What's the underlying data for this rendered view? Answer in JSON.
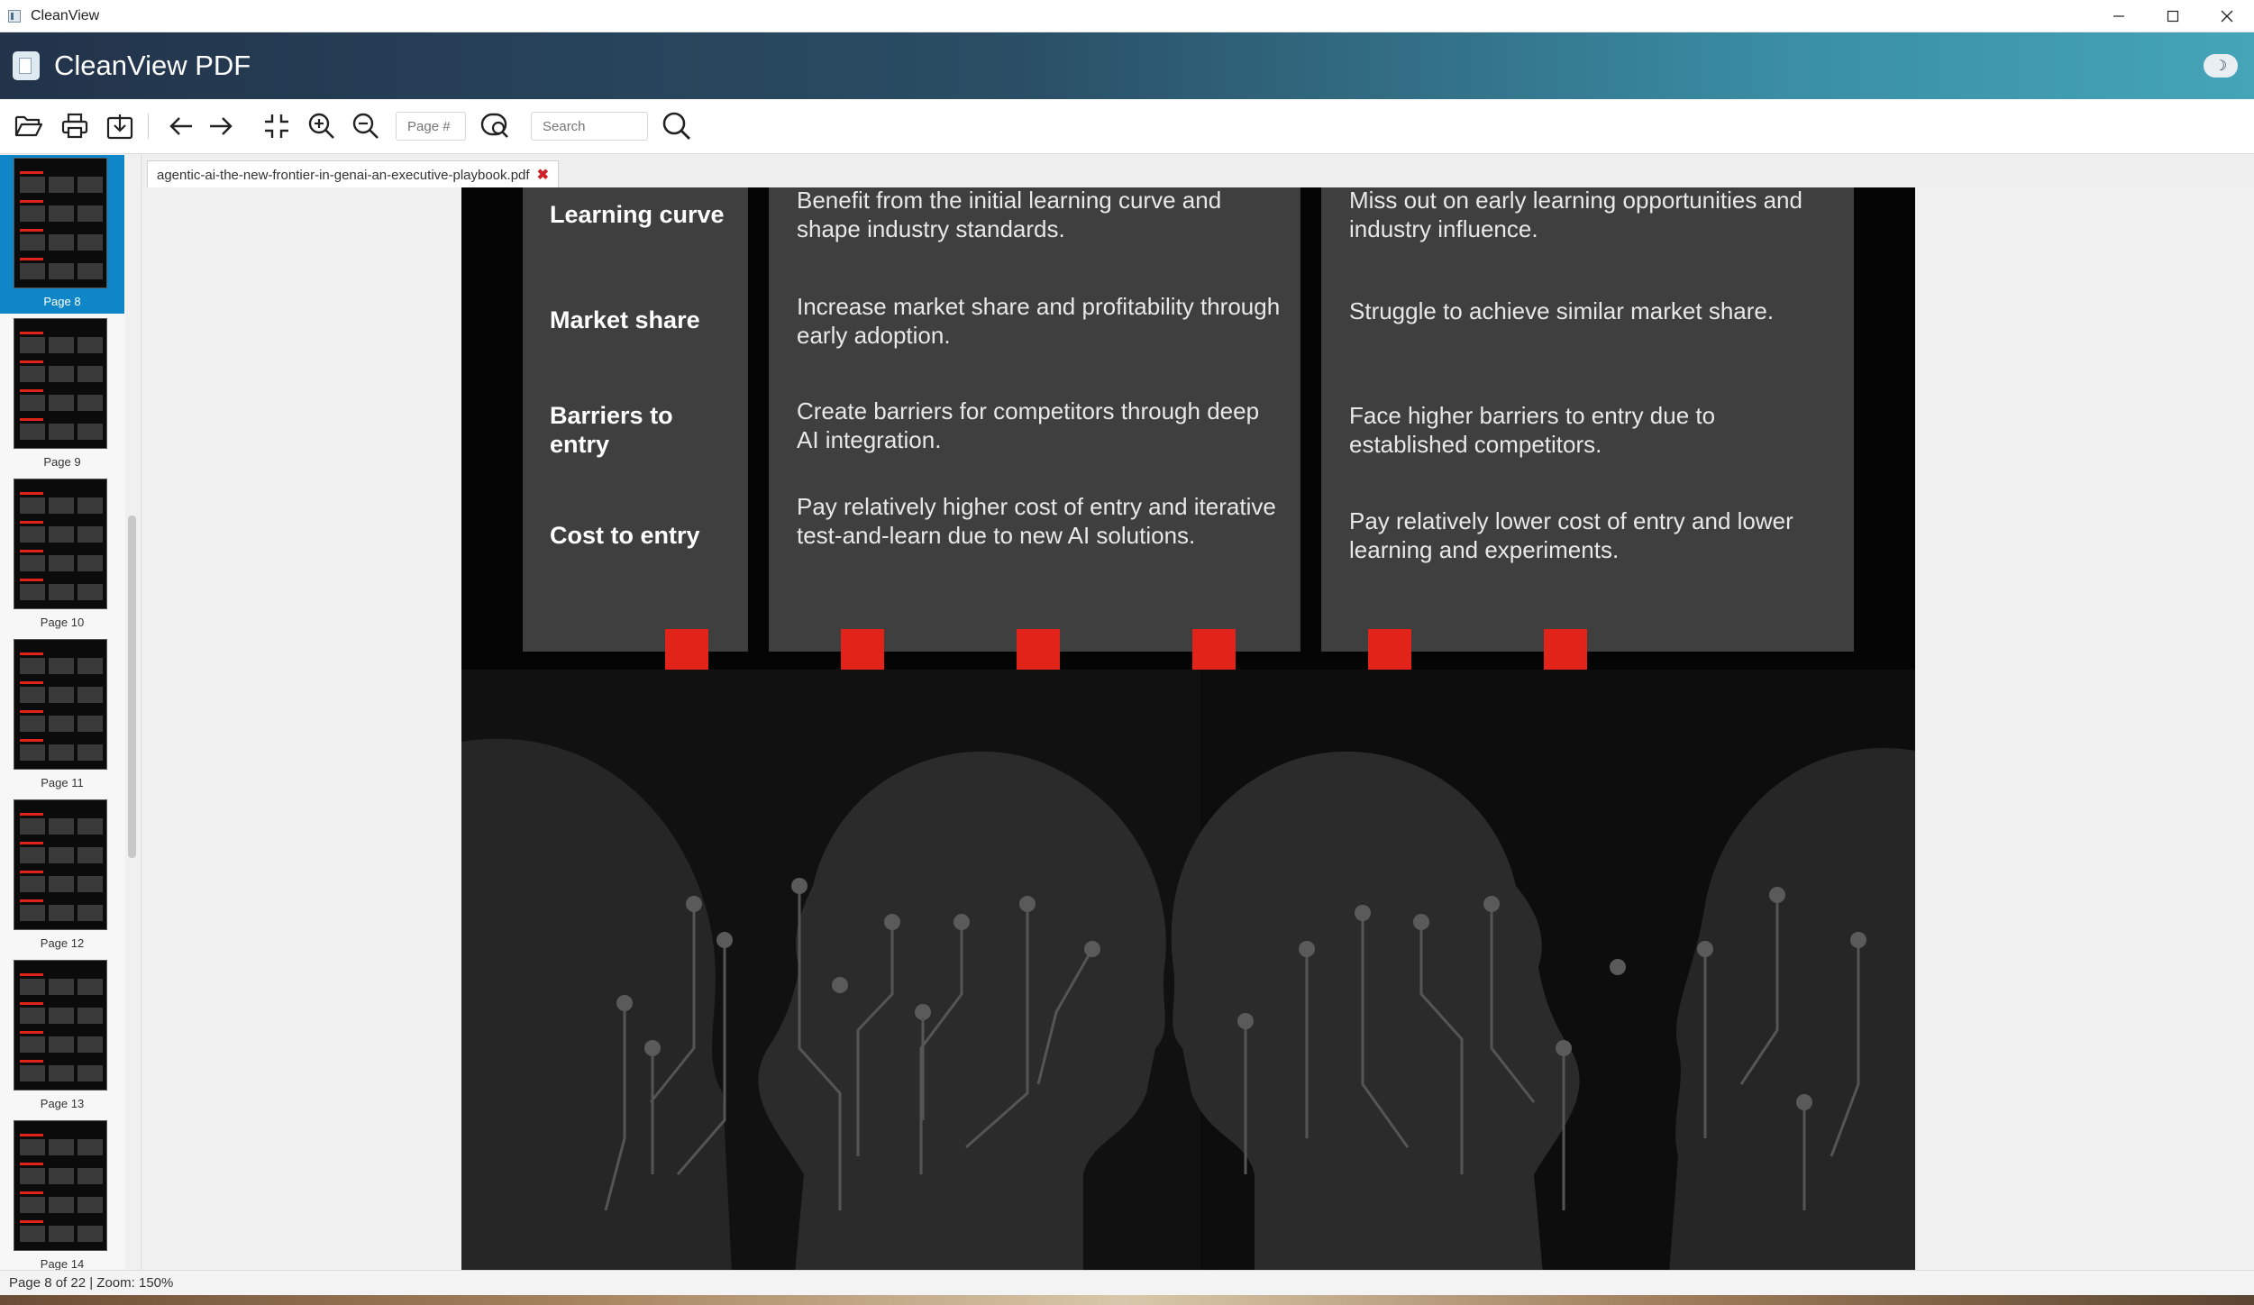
{
  "window": {
    "title": "CleanView"
  },
  "app": {
    "title": "CleanView PDF",
    "theme_toggle_icon": "moon-icon"
  },
  "toolbar": {
    "page_placeholder": "Page #",
    "search_placeholder": "Search"
  },
  "sidebar": {
    "thumbnails": [
      {
        "label": "Page 8",
        "selected": true
      },
      {
        "label": "Page 9"
      },
      {
        "label": "Page 10"
      },
      {
        "label": "Page 11"
      },
      {
        "label": "Page 12"
      },
      {
        "label": "Page 13"
      },
      {
        "label": "Page 14"
      }
    ]
  },
  "tab": {
    "filename": "agentic-ai-the-new-frontier-in-genai-an-executive-playbook.pdf",
    "close_glyph": "✖"
  },
  "document": {
    "rows": [
      {
        "label": "Learning curve",
        "early": "Benefit from the initial learning curve and shape industry standards.",
        "late": "Miss out on early learning opportunities and industry influence."
      },
      {
        "label": "Market share",
        "early": "Increase market share and profitability through early adoption.",
        "late": "Struggle to achieve similar market share."
      },
      {
        "label": "Barriers to entry",
        "early": "Create barriers for competitors through deep AI integration.",
        "late": "Face higher barriers to entry due to established competitors."
      },
      {
        "label": "Cost to entry",
        "early": "Pay relatively higher cost of entry and iterative test-and-learn due to new AI solutions.",
        "late": "Pay relatively lower cost of entry and lower learning and experiments."
      }
    ]
  },
  "status": {
    "text": "Page 8 of 22 | Zoom: 150%"
  },
  "colors": {
    "accent_red": "#e2231a",
    "panel_gray": "#3f3f3f",
    "selection_blue": "#0e86c8"
  }
}
